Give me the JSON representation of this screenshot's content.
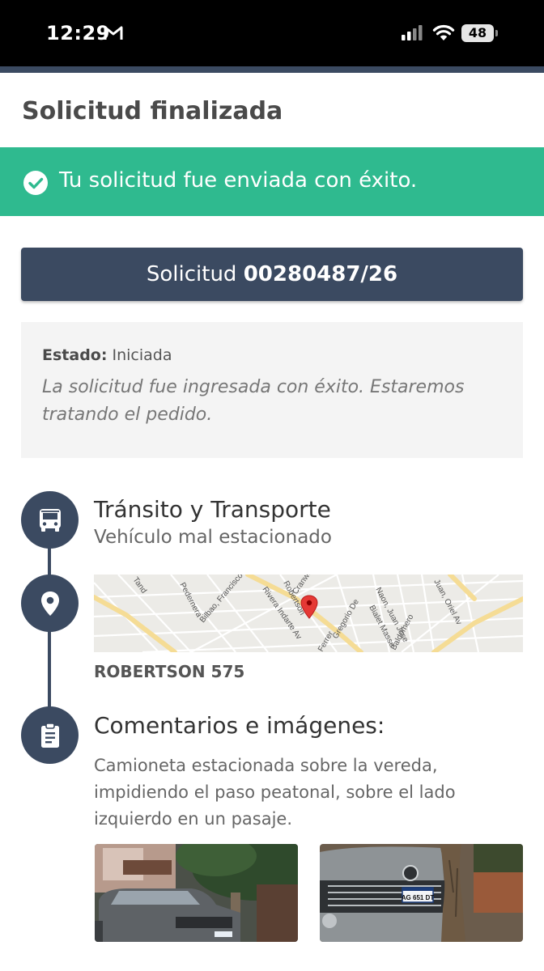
{
  "status_bar": {
    "time": "12:29",
    "battery": "48"
  },
  "header": {
    "title": "Solicitud finalizada"
  },
  "banner": {
    "message": "Tu solicitud fue enviada con éxito."
  },
  "request": {
    "prefix": "Solicitud",
    "number": "00280487/26"
  },
  "status": {
    "label": "Estado:",
    "value": "Iniciada",
    "description": "La solicitud fue ingresada con éxito. Estaremos tratando el pedido."
  },
  "category": {
    "title": "Tránsito y Transporte",
    "subtitle": "Vehículo mal estacionado"
  },
  "location": {
    "address": "ROBERTSON 575",
    "map_labels": [
      "Pedernera",
      "Bilbao, Francisco",
      "Rivera Indarte Av",
      "Cranwell",
      "Robertson",
      "Ferrer",
      "Gregorio De",
      "Bialet Masse",
      "Naon, Juan Jose",
      "Baldomero",
      "Juan, Oriel Av",
      "Tand"
    ]
  },
  "comments": {
    "title": "Comentarios e imágenes:",
    "text": "Camioneta estacionada sobre la vereda, impidiendo el paso peatonal, sobre el lado izquierdo en un pasaje."
  },
  "photos": {
    "plate_text": "AG 651 DT"
  },
  "colors": {
    "primary": "#3b4a61",
    "success": "#2fba8f",
    "marker": "#e53935"
  },
  "icons": {
    "category": "bus-icon",
    "location": "location-pin-icon",
    "comments": "clipboard-icon"
  }
}
